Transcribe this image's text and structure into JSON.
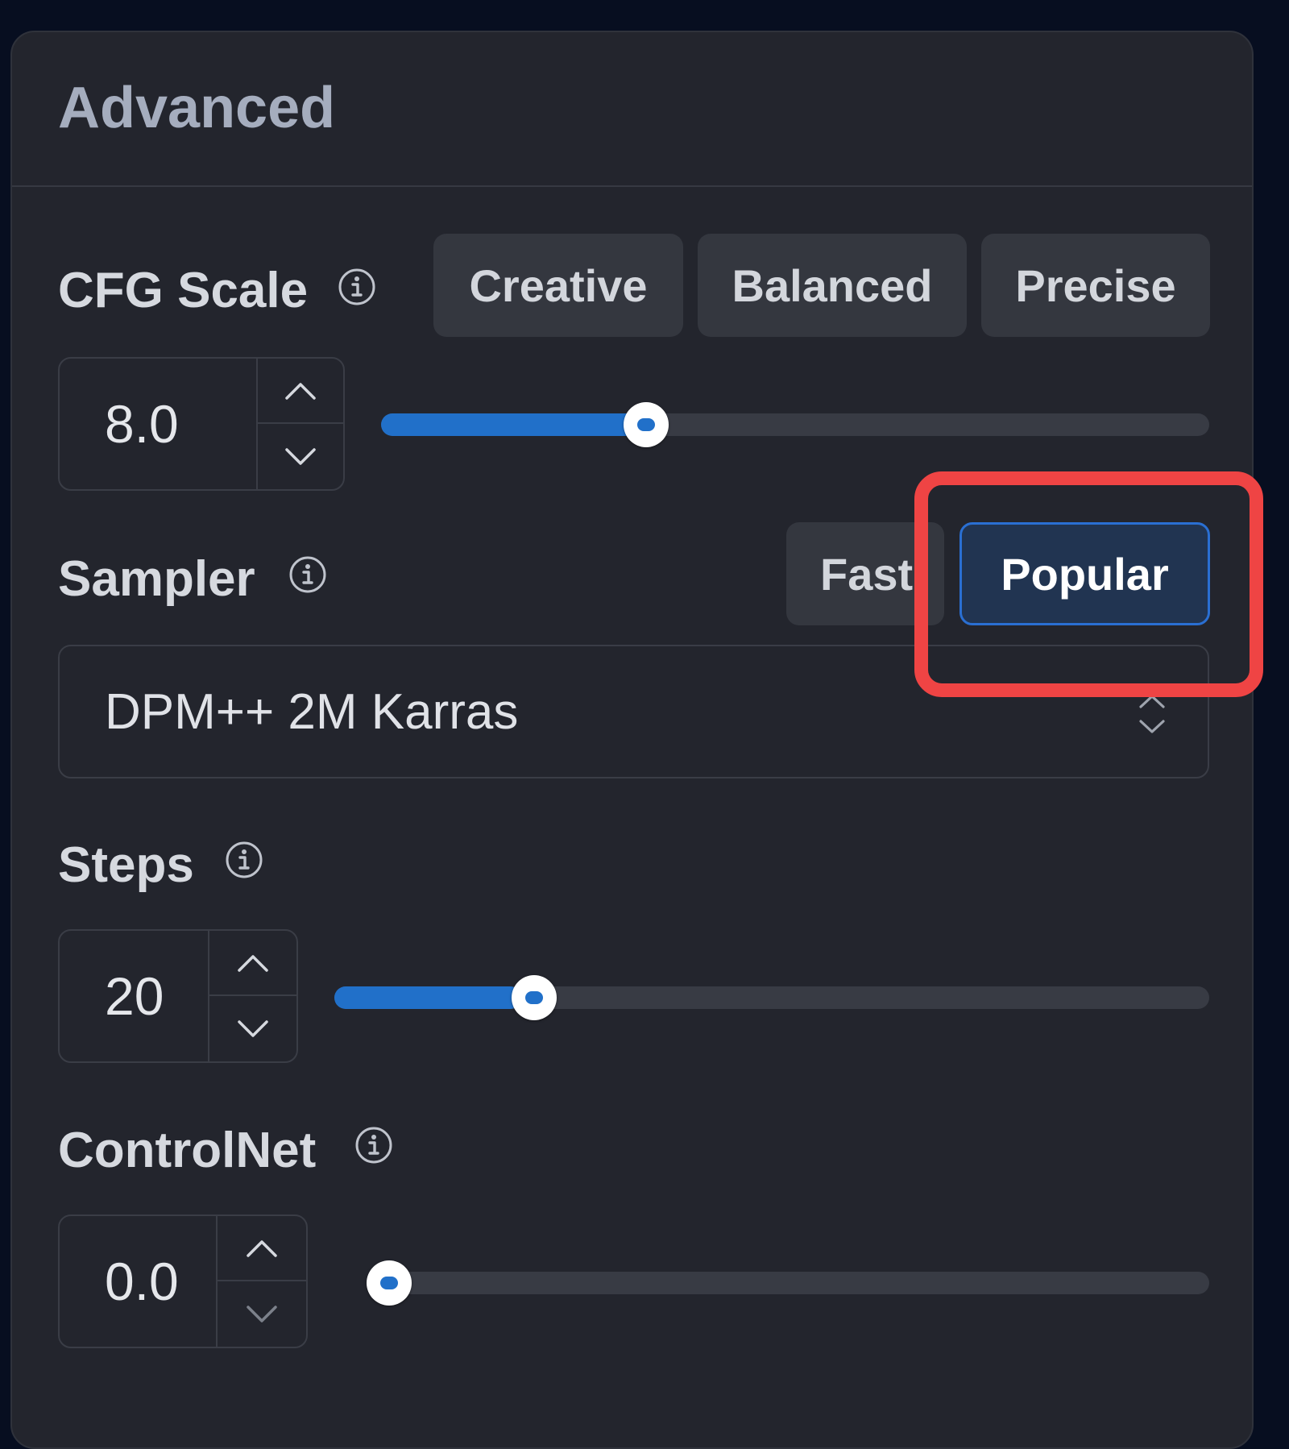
{
  "panel": {
    "title": "Advanced"
  },
  "cfg_scale": {
    "label": "CFG Scale",
    "presets": [
      "Creative",
      "Balanced",
      "Precise"
    ],
    "value": "8.0",
    "slider_fraction": 0.31
  },
  "sampler": {
    "label": "Sampler",
    "filters": [
      "Fast",
      "Popular"
    ],
    "active_filter": "Popular",
    "selected": "DPM++ 2M Karras"
  },
  "steps": {
    "label": "Steps",
    "value": "20",
    "slider_fraction": 0.214
  },
  "controlnet": {
    "label": "ControlNet",
    "value": "0.0",
    "slider_fraction": 0.0
  },
  "colors": {
    "accent": "#2170c9",
    "highlight": "#ef4444",
    "panel_bg": "#23252d",
    "page_bg": "#070e20"
  },
  "icons": {
    "info": "info-circle-icon",
    "up": "chevron-up-icon",
    "down": "chevron-down-icon",
    "select": "chevron-up-down-icon"
  }
}
